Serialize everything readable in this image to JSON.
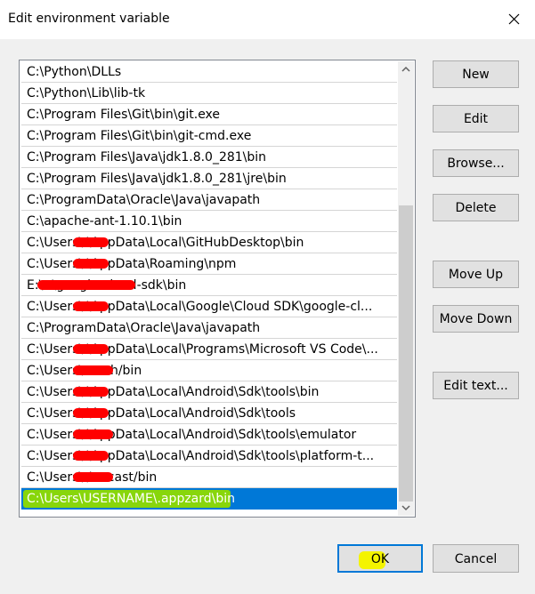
{
  "window": {
    "title": "Edit environment variable"
  },
  "paths": [
    "C:\\Python\\DLLs",
    "C:\\Python\\Lib\\lib-tk",
    "C:\\Program Files\\Git\\bin\\git.exe",
    "C:\\Program Files\\Git\\bin\\git-cmd.exe",
    "C:\\Program Files\\Java\\jdk1.8.0_281\\bin",
    "C:\\Program Files\\Java\\jdk1.8.0_281\\jre\\bin",
    "C:\\ProgramData\\Oracle\\Java\\javapath",
    "C:\\apache-ant-1.10.1\\bin",
    "C:\\Users\\        \\AppData\\Local\\GitHubDesktop\\bin",
    "C:\\Users\\        \\AppData\\Roaming\\npm",
    "E:\\             r\\google-cloud-sdk\\bin",
    "C:\\Users\\        \\AppData\\Local\\Google\\Cloud SDK\\google-cl...",
    "C:\\ProgramData\\Oracle\\Java\\javapath",
    "C:\\Users\\        \\AppData\\Local\\Programs\\Microsoft VS Code\\...",
    "C:\\Users\\        .rush/bin",
    "C:\\Users\\        \\AppData\\Local\\Android\\Sdk\\tools\\bin",
    "C:\\Users\\        \\AppData\\Local\\Android\\Sdk\\tools",
    "C:\\Users\\        \\AppData\\Local\\Android\\Sdk\\tools\\emulator",
    "C:\\Users\\        \\AppData\\Local\\Android\\Sdk\\tools\\platform-t...",
    "C:\\Users\\        /.recast/bin",
    "C:\\Users\\USERNAME\\.appzard\\bin"
  ],
  "selected_index": 20,
  "buttons": {
    "new": "New",
    "edit": "Edit",
    "browse": "Browse...",
    "delete": "Delete",
    "move_up": "Move Up",
    "move_down": "Move Down",
    "edit_text": "Edit text...",
    "ok": "OK",
    "cancel": "Cancel"
  },
  "colors": {
    "selection": "#0078d7",
    "redaction": "#ff0000",
    "highlight_green": "#8fdb00",
    "highlight_yellow": "#f4f400"
  }
}
